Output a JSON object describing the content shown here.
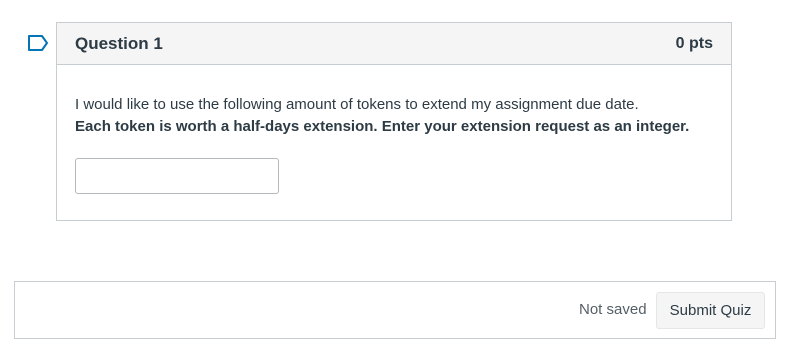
{
  "question": {
    "title": "Question 1",
    "points": "0 pts",
    "prompt": "I would like to use the following amount of tokens to extend my assignment due date.",
    "instruction": "Each token is worth a half-days extension. Enter your extension request as an integer.",
    "answer_value": "",
    "flag_icon": "bookmark-flag-icon"
  },
  "footer": {
    "save_status": "Not saved",
    "submit_label": "Submit Quiz"
  },
  "colors": {
    "flag": "#0374b5",
    "header_bg": "#f5f5f5",
    "border": "#c7cdd1",
    "text": "#2d3b45"
  }
}
